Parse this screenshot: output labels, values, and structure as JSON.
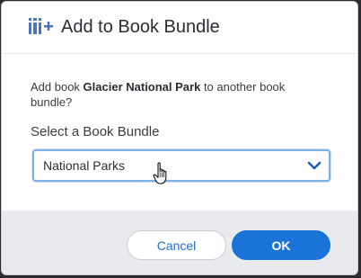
{
  "dialog": {
    "title": "Add to Book Bundle",
    "icon": "book-bundle-add-icon",
    "description_prefix": "Add book ",
    "book_name": "Glacier National Park",
    "description_suffix": " to another book bundle?",
    "select_label": "Select a Book Bundle",
    "select_value": "National Parks",
    "cancel_label": "Cancel",
    "ok_label": "OK"
  },
  "colors": {
    "primary": "#1a73d9",
    "footer_bg": "#e8eaee",
    "focus_border": "#7fb0e3"
  }
}
